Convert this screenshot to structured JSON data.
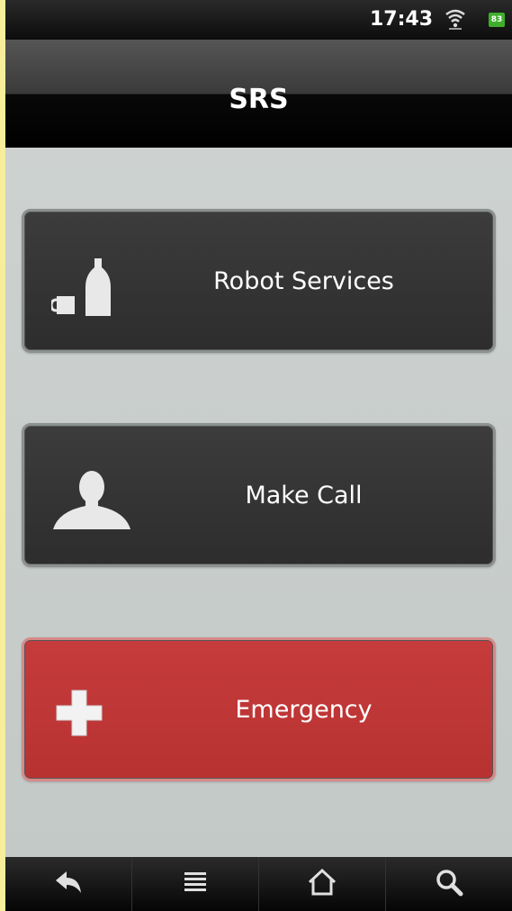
{
  "status_bar": {
    "time": "17:43",
    "battery_level": "83",
    "icons": [
      "wifi-icon",
      "battery-icon"
    ]
  },
  "header": {
    "title": "SRS"
  },
  "menu": {
    "items": [
      {
        "label": "Robot Services",
        "icon": "cup-bottle-icon",
        "color": "#333333"
      },
      {
        "label": "Make Call",
        "icon": "person-icon",
        "color": "#333333"
      },
      {
        "label": "Emergency",
        "icon": "plus-cross-icon",
        "color": "#bd3535"
      }
    ]
  },
  "nav_bar": {
    "buttons": [
      "back-icon",
      "menu-icon",
      "home-icon",
      "search-icon"
    ]
  },
  "colors": {
    "background": "#c9cfcd",
    "dark_button": "#333333",
    "emergency_button": "#bd3535",
    "battery": "#3fae2b"
  }
}
